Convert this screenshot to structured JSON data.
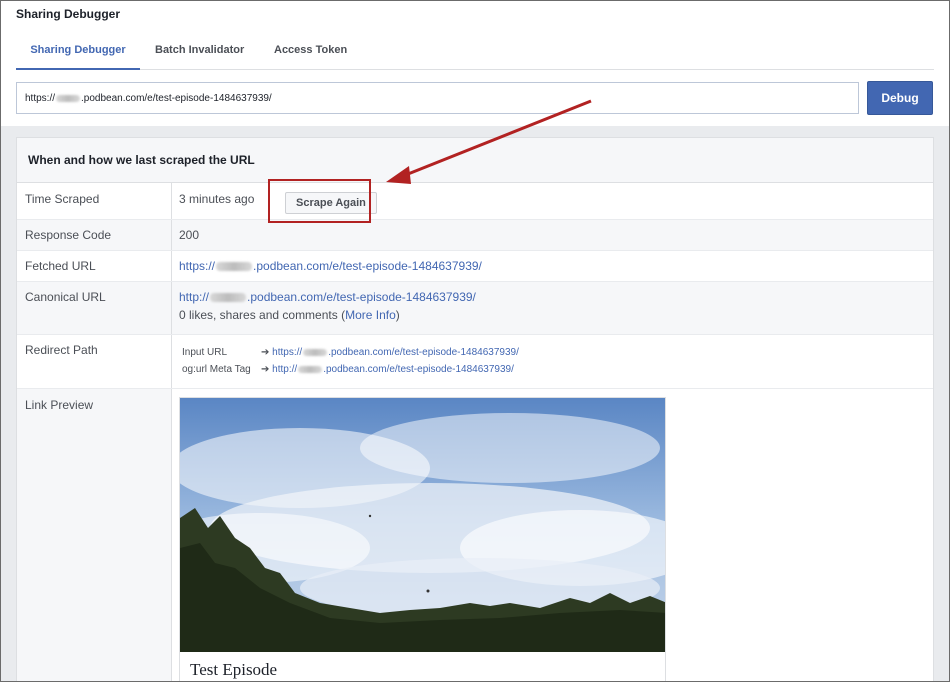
{
  "app": {
    "title": "Sharing Debugger"
  },
  "tabs": [
    {
      "label": "Sharing Debugger",
      "active": true
    },
    {
      "label": "Batch Invalidator",
      "active": false
    },
    {
      "label": "Access Token",
      "active": false
    }
  ],
  "url_input": {
    "prefix": "https://",
    "suffix": ".podbean.com/e/test-episode-1484637939/"
  },
  "debug_button": {
    "label": "Debug"
  },
  "panel": {
    "title": "When and how we last scraped the URL",
    "rows": {
      "time_scraped": {
        "label": "Time Scraped",
        "value": "3 minutes ago",
        "button": "Scrape Again"
      },
      "response_code": {
        "label": "Response Code",
        "value": "200"
      },
      "fetched_url": {
        "label": "Fetched URL",
        "prefix": "https://",
        "suffix": ".podbean.com/e/test-episode-1484637939/"
      },
      "canonical_url": {
        "label": "Canonical URL",
        "prefix": "http://",
        "suffix": ".podbean.com/e/test-episode-1484637939/",
        "engagement_text": "0 likes, shares and comments (",
        "more_info": "More Info",
        "engagement_close": ")"
      },
      "redirect_path": {
        "label": "Redirect Path",
        "input_label": "Input URL",
        "input_prefix": "https://",
        "input_suffix": ".podbean.com/e/test-episode-1484637939/",
        "meta_label": "og:url Meta Tag",
        "meta_prefix": "http://",
        "meta_suffix": ".podbean.com/e/test-episode-1484637939/",
        "arrow": "➔"
      },
      "link_preview": {
        "label": "Link Preview",
        "title": "Test Episode"
      }
    }
  },
  "colors": {
    "accent": "#4267b2",
    "annotation": "#b22222",
    "background": "#e9ebee"
  },
  "icons": {
    "annotation": "red-arrow-icon",
    "redirect": "right-arrow-icon"
  }
}
